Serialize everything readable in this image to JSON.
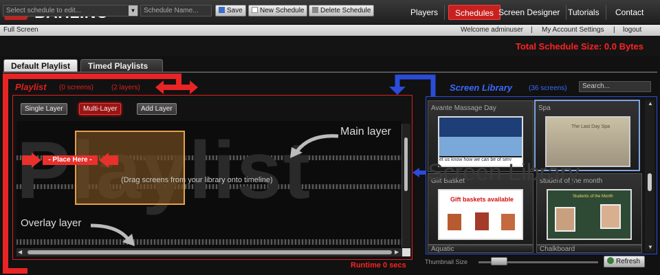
{
  "brand": {
    "logo_text": "BAHLINC",
    "accent": "#c8201e"
  },
  "nav": {
    "items": [
      {
        "label": "Players",
        "active": false
      },
      {
        "label": "Schedules",
        "active": true
      },
      {
        "label": "Screen Designer",
        "active": false
      },
      {
        "label": "Tutorials",
        "active": false
      },
      {
        "label": "Contact",
        "active": false
      }
    ]
  },
  "subbar": {
    "full_screen": "Full Screen",
    "welcome": "Welcome adminuser",
    "divider": "|",
    "account": "My Account Settings",
    "logout": "logout"
  },
  "toolbar": {
    "schedule_select_placeholder": "Select schedule to edit...",
    "schedule_name_placeholder": "Schedule Name...",
    "save_label": "Save",
    "new_label": "New Schedule",
    "delete_label": "Delete Schedule",
    "total_size": "Total Schedule Size: 0.0 Bytes"
  },
  "tabs": [
    {
      "label": "Default Playlist",
      "active": true
    },
    {
      "label": "Timed Playlists",
      "active": false
    }
  ],
  "playlist": {
    "title": "Playlist",
    "screens": "(0 screens)",
    "layers": "(2 layers)",
    "buttons": [
      "Single Layer",
      "Multi-Layer",
      "Add Layer"
    ],
    "active_button": "Multi-Layer",
    "watermark": "Playlist",
    "drag_hint": "(Drag screens from your library onto timeline)",
    "place_here": "- Place Here -",
    "main_layer": "Main layer",
    "overlay_layer": "Overlay layer",
    "runtime": "Runtime 0 secs"
  },
  "library": {
    "title": "Screen Library",
    "count": "(36 screens)",
    "search_placeholder": "Search...",
    "watermark": "Screen Library",
    "cards": [
      {
        "title": "Avante Massage Day",
        "selected": false
      },
      {
        "title": "Spa",
        "selected": true
      },
      {
        "title": "Gift Basket",
        "selected": false
      },
      {
        "title": "student of the month",
        "selected": false
      },
      {
        "title": "Aquatic",
        "selected": false
      },
      {
        "title": "Chalkboard",
        "selected": false
      }
    ],
    "thumbs": {
      "massage_caption": "et us know how we can be of serv",
      "spa_caption": "The Last Day Spa",
      "gift_caption": "Gift baskets available",
      "student_caption": "Students of the Month"
    },
    "thumbnail_size_label": "Thumbnail Size",
    "thumbnail_size_value": 0.15,
    "refresh_label": "Refresh"
  },
  "colors": {
    "playlist": "#e02020",
    "library": "#2a4cd8",
    "place_here": "#e8302c"
  }
}
